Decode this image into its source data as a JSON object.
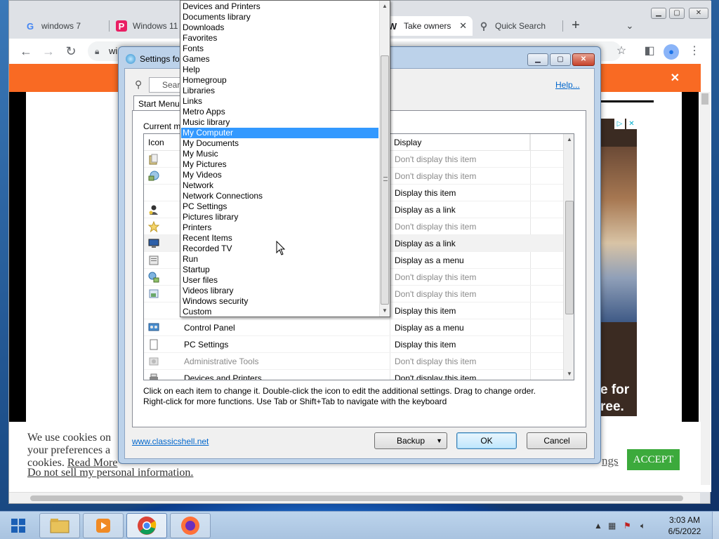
{
  "browser": {
    "tabs": [
      {
        "title": "windows 7",
        "favicon": "G",
        "favicon_color": "#4285f4"
      },
      {
        "title": "Windows 11",
        "favicon": "P",
        "favicon_color": "#e91e63"
      },
      {
        "title": "Take owners",
        "favicon": "W",
        "favicon_color": "#000000"
      },
      {
        "title": "Quick Search",
        "favicon": "search-icon",
        "favicon_color": "#5f6368"
      }
    ],
    "new_tab_label": "+",
    "address_fragment": "wi",
    "banner_color": "#f96a23"
  },
  "page": {
    "ad_text_1": "e for",
    "ad_text_2": "ree.",
    "ad_badges": [
      "▷",
      "✕"
    ],
    "cookie": {
      "line1": "We use cookies on",
      "line2": "your preferences a",
      "line3_prefix": "cookies. ",
      "read_more": "Read More",
      "do_not_sell": "Do not sell my personal information.",
      "settings_fragment": "ngs",
      "accept_label": "ACCEPT",
      "accept_color": "#3caa3c"
    }
  },
  "dialog": {
    "title": "Settings fo",
    "search_placeholder": "Search",
    "help_link": "Help...",
    "tab_label": "Start Menu",
    "current_label": "Current m",
    "columns": {
      "icon": "Icon",
      "display": "Display"
    },
    "rows": [
      {
        "icon": "folder-icon",
        "name": "",
        "display": "Don't display this item",
        "dim": true
      },
      {
        "icon": "network-icon",
        "name": "",
        "display": "Don't display this item",
        "dim": true
      },
      {
        "icon": "",
        "name": "",
        "display": "Display this item",
        "dim": false
      },
      {
        "icon": "user-icon",
        "name": "",
        "display": "Display as a link",
        "dim": false
      },
      {
        "icon": "star-icon",
        "name": "",
        "display": "Don't display this item",
        "dim": true
      },
      {
        "icon": "monitor-icon",
        "name": "",
        "display": "Display as a link",
        "dim": false,
        "selected": true
      },
      {
        "icon": "document-icon",
        "name": "",
        "display": "Display as a menu",
        "dim": false
      },
      {
        "icon": "connections-icon",
        "name": "",
        "display": "Don't display this item",
        "dim": true
      },
      {
        "icon": "pictures-icon",
        "name": "",
        "display": "Don't display this item",
        "dim": true
      },
      {
        "icon": "",
        "name": "",
        "display": "Display this item",
        "dim": false
      },
      {
        "icon": "control-panel-icon",
        "name": "Control Panel",
        "display": "Display as a menu",
        "dim": false
      },
      {
        "icon": "page-icon",
        "name": "PC Settings",
        "display": "Display this item",
        "dim": false
      },
      {
        "icon": "admin-tools-icon",
        "name": "Administrative Tools",
        "display": "Don't display this item",
        "dim": true
      },
      {
        "icon": "printer-icon",
        "name": "Devices and Printers",
        "display": "Don't display this item",
        "dim": true
      }
    ],
    "instructions_1": "Click on each item to change it. Double-click the icon to edit the additional settings. Drag to change order.",
    "instructions_2": "Right-click for more functions. Use Tab or Shift+Tab to navigate with the keyboard",
    "classic_link": "www.classicshell.net",
    "backup_label": "Backup",
    "ok_label": "OK",
    "cancel_label": "Cancel"
  },
  "dropdown": {
    "items": [
      "Devices and Printers",
      "Documents library",
      "Downloads",
      "Favorites",
      "Fonts",
      "Games",
      "Help",
      "Homegroup",
      "Libraries",
      "Links",
      "Metro Apps",
      "Music library",
      "My Computer",
      "My Documents",
      "My Music",
      "My Pictures",
      "My Videos",
      "Network",
      "Network Connections",
      "PC Settings",
      "Pictures library",
      "Printers",
      "Recent Items",
      "Recorded TV",
      "Run",
      "Startup",
      "User files",
      "Videos library",
      "Windows security",
      "Custom"
    ],
    "selected_index": 12,
    "selection_color": "#3399ff"
  },
  "taskbar": {
    "apps": [
      {
        "name": "file-explorer",
        "color": "#e8c25a"
      },
      {
        "name": "media-player",
        "color": "#f08a24"
      },
      {
        "name": "chrome",
        "color": "#db4437"
      },
      {
        "name": "firefox",
        "color": "#ff7139"
      }
    ],
    "time": "3:03 AM",
    "date": "6/5/2022"
  }
}
